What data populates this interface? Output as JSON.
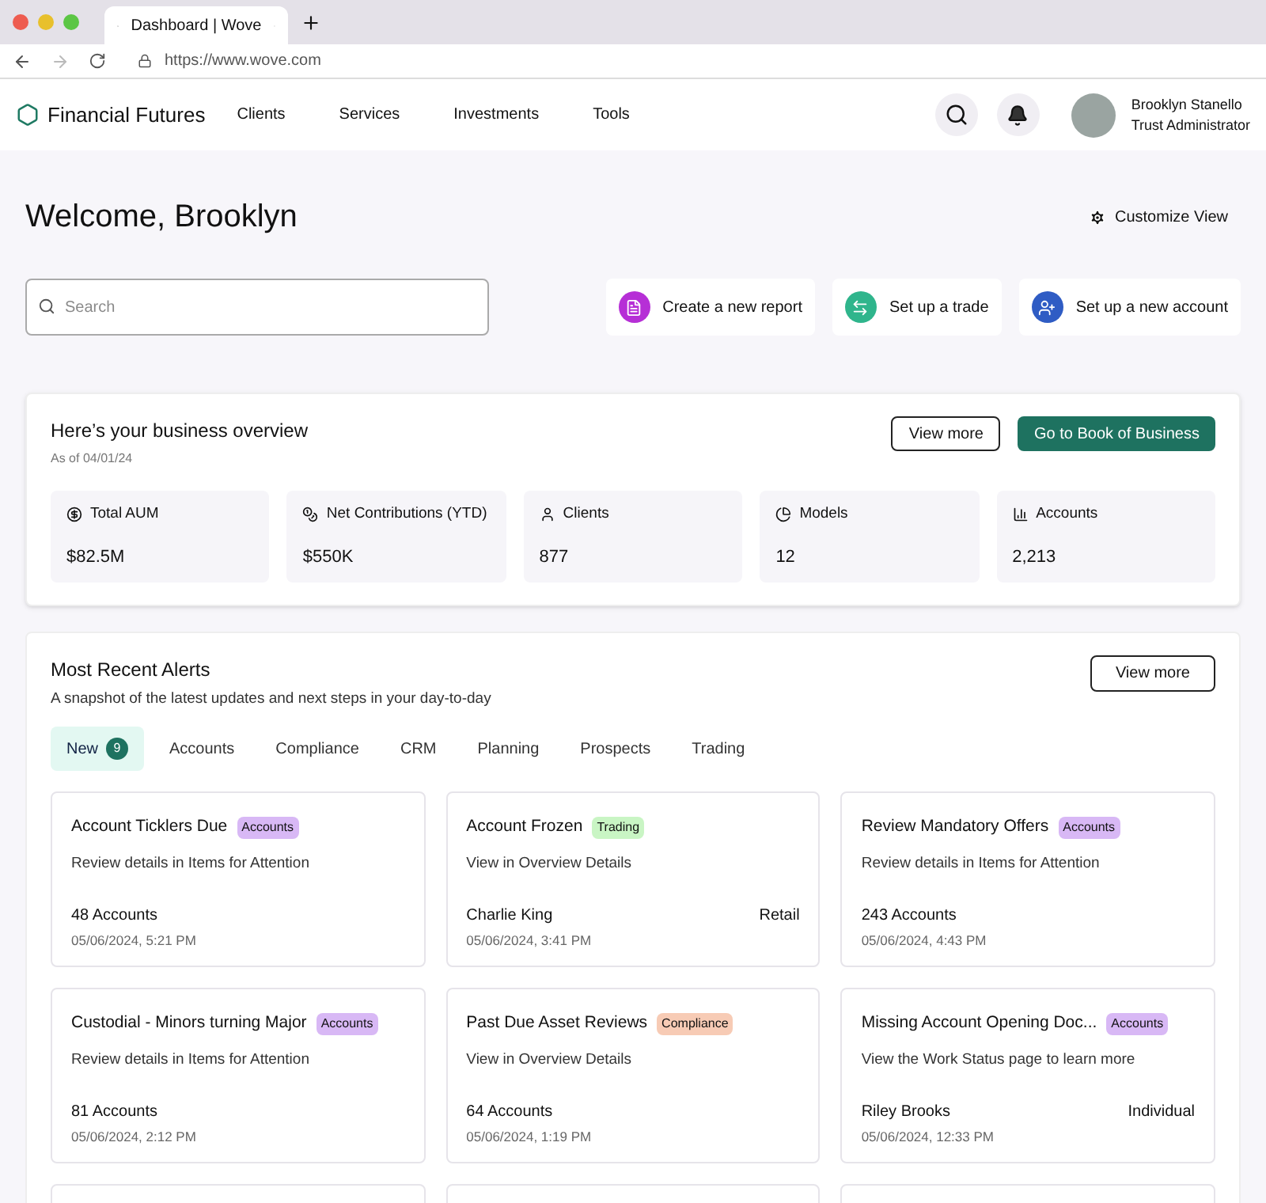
{
  "browser": {
    "tab_title": "Dashboard | Wove",
    "url": "https://www.wove.com"
  },
  "nav": {
    "brand": "Financial Futures",
    "links": [
      "Clients",
      "Services",
      "Investments",
      "Tools"
    ],
    "user": {
      "name": "Brooklyn Stanello",
      "role": "Trust Administrator"
    }
  },
  "header": {
    "title": "Welcome, Brooklyn",
    "customize": "Customize View",
    "search": {
      "placeholder": "Search"
    },
    "actions": [
      {
        "label": "Create a new report",
        "kind": "report",
        "color": "#b62fd6"
      },
      {
        "label": "Set up a trade",
        "kind": "trade",
        "color": "#2fb58c"
      },
      {
        "label": "Set up a new account",
        "kind": "account",
        "color": "#2f5cc4"
      }
    ]
  },
  "overview": {
    "title": "Here’s your business overview",
    "as_of": "As of 04/01/24",
    "view_more": "View more",
    "book_button": "Go to Book of Business",
    "stats": [
      {
        "kind": "dollar",
        "label": "Total AUM",
        "value": "$82.5M"
      },
      {
        "kind": "coins",
        "label": "Net Contributions (YTD)",
        "value": "$550K"
      },
      {
        "kind": "person",
        "label": "Clients",
        "value": "877"
      },
      {
        "kind": "pie",
        "label": "Models",
        "value": "12"
      },
      {
        "kind": "chart",
        "label": "Accounts",
        "value": "2,213"
      }
    ]
  },
  "alerts": {
    "title": "Most Recent Alerts",
    "subtitle": "A snapshot of the latest updates and next steps in your day-to-day",
    "view_more": "View more",
    "tabs": [
      {
        "label": "New",
        "count": "9",
        "selected": true
      },
      {
        "label": "Accounts",
        "selected": false
      },
      {
        "label": "Compliance",
        "selected": false
      },
      {
        "label": "CRM",
        "selected": false
      },
      {
        "label": "Planning",
        "selected": false
      },
      {
        "label": "Prospects",
        "selected": false
      },
      {
        "label": "Trading",
        "selected": false
      }
    ],
    "cards": [
      {
        "title": "Account Ticklers Due",
        "tag": "Accounts",
        "color": "#d8b8f5",
        "description": "Review details in Items for Attention",
        "primary": "48 Accounts",
        "time": "05/06/2024, 5:21 PM"
      },
      {
        "title": "Account Frozen",
        "tag": "Trading",
        "color": "#c9f5c4",
        "description": "View in Overview Details",
        "primary": "Charlie King",
        "secondary": "Retail",
        "time": "05/06/2024, 3:41 PM"
      },
      {
        "title": "Review Mandatory Offers",
        "tag": "Accounts",
        "color": "#d8b8f5",
        "description": "Review details in Items for Attention",
        "primary": "243 Accounts",
        "time": "05/06/2024, 4:43 PM"
      },
      {
        "title": "Custodial - Minors turning Major",
        "tag": "Accounts",
        "color": "#d8b8f5",
        "description": "Review details in Items for Attention",
        "primary": "81 Accounts",
        "time": "05/06/2024, 2:12 PM"
      },
      {
        "title": "Past Due Asset Reviews",
        "tag": "Compliance",
        "color": "#f7cbb5",
        "description": "View in Overview Details",
        "primary": "64 Accounts",
        "time": "05/06/2024, 1:19 PM"
      },
      {
        "title": "Missing Account Opening Doc...",
        "tag": "Accounts",
        "color": "#d8b8f5",
        "description": "View the Work Status page to learn more",
        "primary": "Riley Brooks",
        "secondary": "Individual",
        "time": "05/06/2024, 12:33 PM"
      }
    ]
  }
}
